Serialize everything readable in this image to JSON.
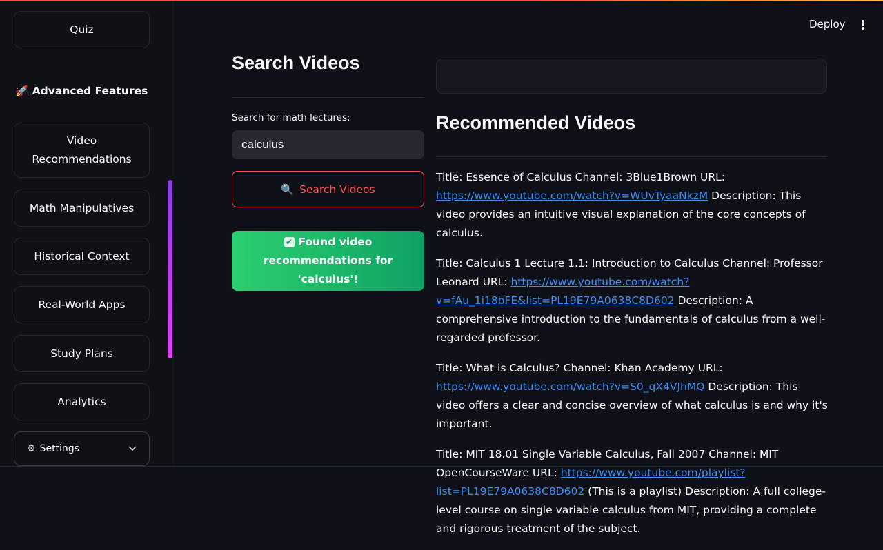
{
  "sidebar": {
    "top_item": "Quiz",
    "section_label": "Advanced Features",
    "section_icon": "rocket-icon",
    "items": [
      "Video Recommendations",
      "Math Manipulatives",
      "Historical Context",
      "Real-World Apps",
      "Study Plans",
      "Analytics"
    ],
    "settings_label": "Settings"
  },
  "header": {
    "deploy_label": "Deploy"
  },
  "search": {
    "heading": "Search Videos",
    "input_label": "Search for math lectures:",
    "input_value": "calculus",
    "button_label": "Search Videos",
    "success_message": "Found video recommendations for 'calculus'!"
  },
  "recommendations": {
    "heading": "Recommended Videos",
    "videos": [
      {
        "pre": "Title: Essence of Calculus Channel: 3Blue1Brown URL: ",
        "url": "https://www.youtube.com/watch?v=WUvTyaaNkzM",
        "post": " Description: This video provides an intuitive visual explanation of the core concepts of calculus."
      },
      {
        "pre": "Title: Calculus 1 Lecture 1.1: Introduction to Calculus Channel: Professor Leonard URL: ",
        "url": "https://www.youtube.com/watch?v=fAu_1i18bFE&list=PL19E79A0638C8D602",
        "post": " Description: A comprehensive introduction to the fundamentals of calculus from a well-regarded professor."
      },
      {
        "pre": "Title: What is Calculus? Channel: Khan Academy URL: ",
        "url": "https://www.youtube.com/watch?v=S0_qX4VJhMQ",
        "post": " Description: This video offers a clear and concise overview of what calculus is and why it's important."
      },
      {
        "pre": "Title: MIT 18.01 Single Variable Calculus, Fall 2007 Channel: MIT OpenCourseWare URL: ",
        "url": "https://www.youtube.com/playlist?list=PL19E79A0638C8D602",
        "post": " (This is a playlist) Description: A full college-level course on single variable calculus from MIT, providing a complete and rigorous treatment of the subject."
      }
    ]
  },
  "colors": {
    "accent": "#ff4b4b",
    "success_start": "#2ad06f",
    "success_end": "#0fa264",
    "link": "#3e8df5",
    "scrollbar": "#c13bf0"
  }
}
